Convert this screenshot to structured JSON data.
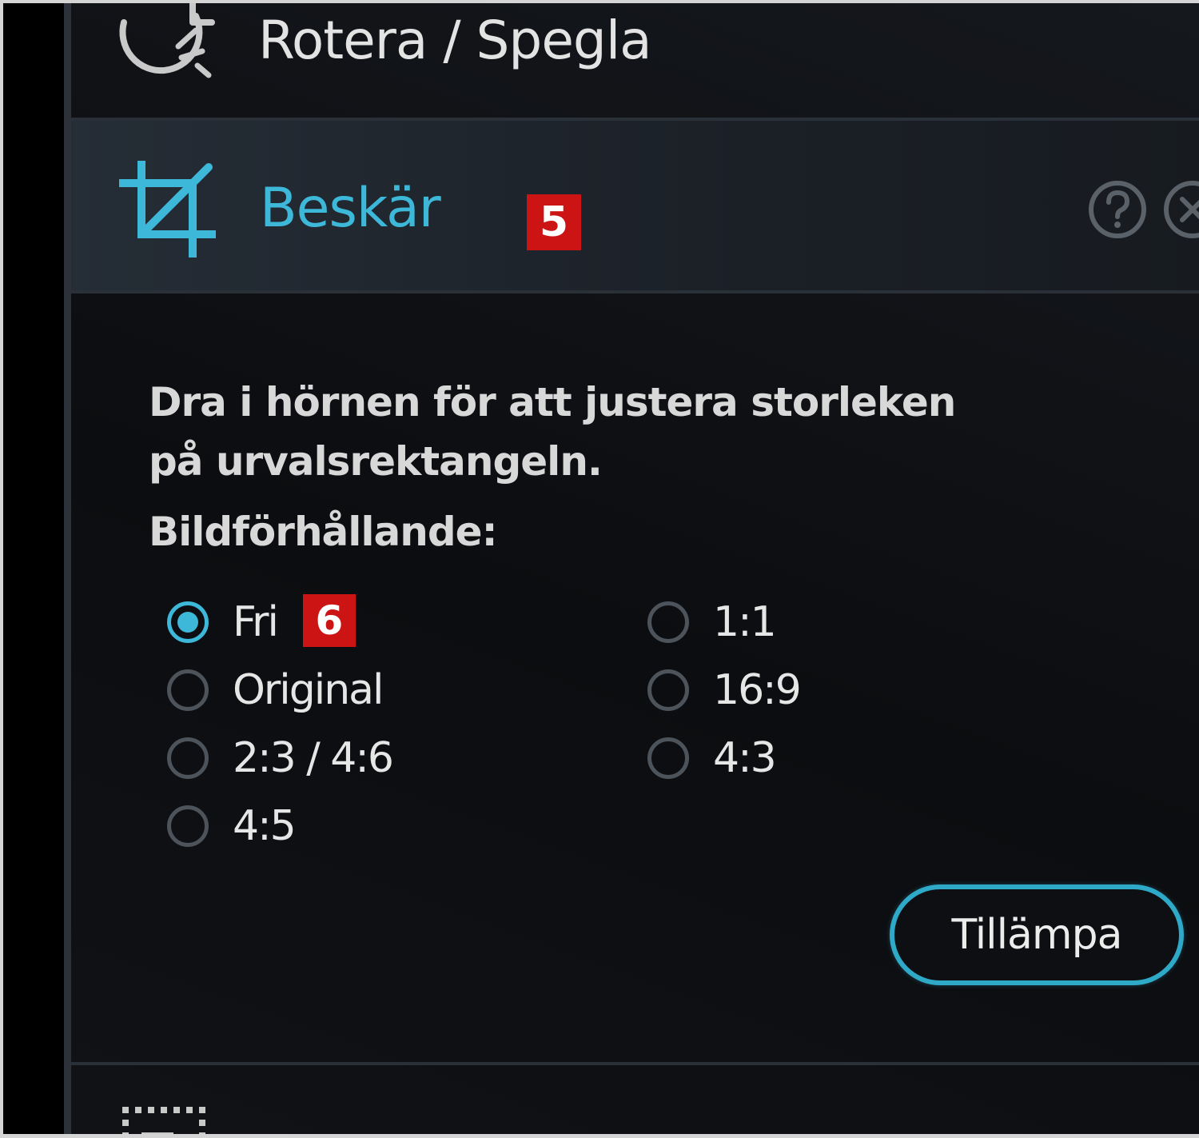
{
  "rotate_section": {
    "label": "Rotera / Spegla",
    "icon": "rotate-icon"
  },
  "crop_section": {
    "label": "Beskär",
    "icon": "crop-icon",
    "accent_color": "#3db8d8",
    "marker": "5",
    "help_icon": "help-icon",
    "close_icon": "close-icon"
  },
  "crop_body": {
    "instructions": "Dra i hörnen för att justera storleken på urvalsrektangeln.",
    "aspect_heading": "Bildförhållande:",
    "options_left": [
      {
        "label": "Fri",
        "selected": true
      },
      {
        "label": "Original",
        "selected": false
      },
      {
        "label": "2:3 / 4:6",
        "selected": false
      },
      {
        "label": "4:5",
        "selected": false
      }
    ],
    "options_right": [
      {
        "label": "1:1",
        "selected": false
      },
      {
        "label": "16:9",
        "selected": false
      },
      {
        "label": "4:3",
        "selected": false
      }
    ],
    "option_marker": "6",
    "apply_label": "Tillämpa"
  },
  "colors": {
    "background": "#0e0f12",
    "accent": "#3db8d8",
    "marker_red": "#cc1414"
  }
}
